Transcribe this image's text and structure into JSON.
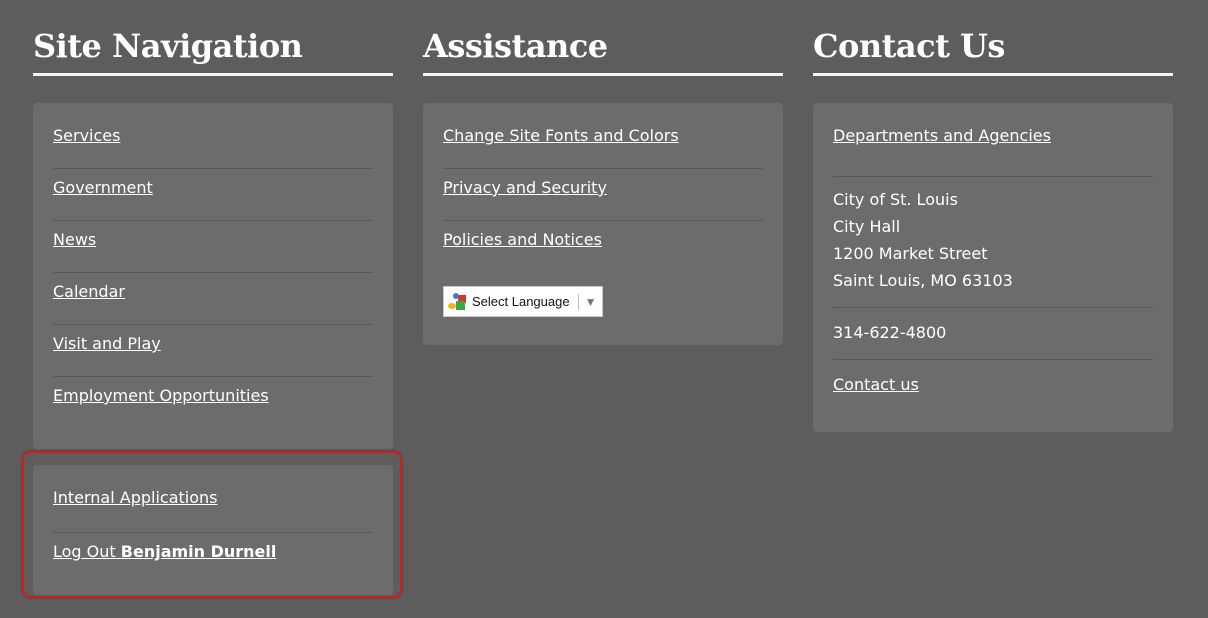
{
  "columns": {
    "site_navigation": {
      "heading": "Site Navigation",
      "links": [
        {
          "label": "Services"
        },
        {
          "label": "Government"
        },
        {
          "label": "News"
        },
        {
          "label": "Calendar"
        },
        {
          "label": "Visit and Play"
        },
        {
          "label": "Employment Opportunities"
        }
      ],
      "internal": {
        "internal_apps_label": "Internal Applications",
        "logout_prefix": "Log Out",
        "logout_user": "Benjamin Durnell"
      }
    },
    "assistance": {
      "heading": "Assistance",
      "links": [
        {
          "label": "Change Site Fonts and Colors"
        },
        {
          "label": "Privacy and Security"
        },
        {
          "label": "Policies and Notices"
        }
      ],
      "language_select": {
        "label": "Select Language",
        "icon": "google-translate-icon",
        "arrow": "▼"
      }
    },
    "contact_us": {
      "heading": "Contact Us",
      "departments_link": "Departments and Agencies",
      "address": [
        "City of St. Louis",
        "City Hall",
        "1200 Market Street",
        "Saint Louis, MO 63103"
      ],
      "phone": "314-622-4800",
      "contact_link": "Contact us"
    }
  },
  "colors": {
    "background": "#5f5d5b",
    "panel": "#6e6c6a",
    "highlight_border": "#d51c1c"
  }
}
